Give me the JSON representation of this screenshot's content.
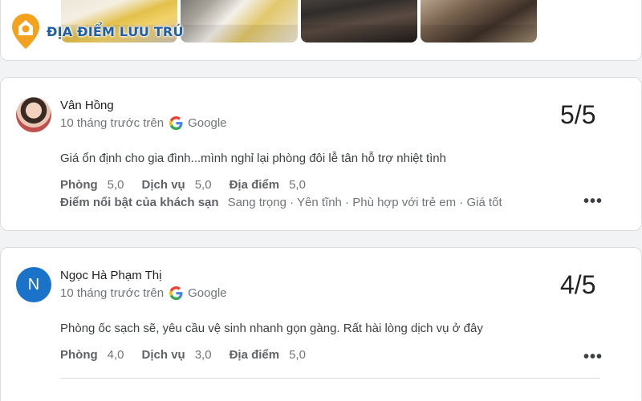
{
  "logo": {
    "text": "ĐỊA ĐIỂM LƯU TRÚ"
  },
  "photos": [
    "hotel-bedroom-photo",
    "hotel-room-window-photo",
    "hotel-lounge-photo",
    "hotel-living-room-photo"
  ],
  "reviews": [
    {
      "name": "Vân Hồng",
      "time": "10 tháng trước trên",
      "source": "Google",
      "score": "5/5",
      "text": "Giá ổn định cho gia đình...mình nghỉ lại phòng đôi lễ tân hỗ trợ nhiệt tình",
      "ratings": [
        {
          "label": "Phòng",
          "value": "5,0"
        },
        {
          "label": "Dịch vụ",
          "value": "5,0"
        },
        {
          "label": "Địa điểm",
          "value": "5,0"
        }
      ],
      "highlights_label": "Điểm nổi bật của khách sạn",
      "highlights": "Sang trọng · Yên tĩnh · Phù hợp với trẻ em · Giá tốt",
      "more": "•••"
    },
    {
      "name": "Ngọc Hà Phạm Thị",
      "avatar_letter": "N",
      "time": "10 tháng trước trên",
      "source": "Google",
      "score": "4/5",
      "text": "Phòng ốc sạch sẽ, yêu cầu vệ sinh nhanh gọn gàng. Rất hài lòng dịch vụ ở đây",
      "ratings": [
        {
          "label": "Phòng",
          "value": "4,0"
        },
        {
          "label": "Dịch vụ",
          "value": "3,0"
        },
        {
          "label": "Địa điểm",
          "value": "5,0"
        }
      ],
      "more": "•••"
    }
  ],
  "colors": {
    "logo_blue": "#1f5fa8",
    "logo_orange": "#f4a21d",
    "avatar_blue": "#1a73c8"
  }
}
